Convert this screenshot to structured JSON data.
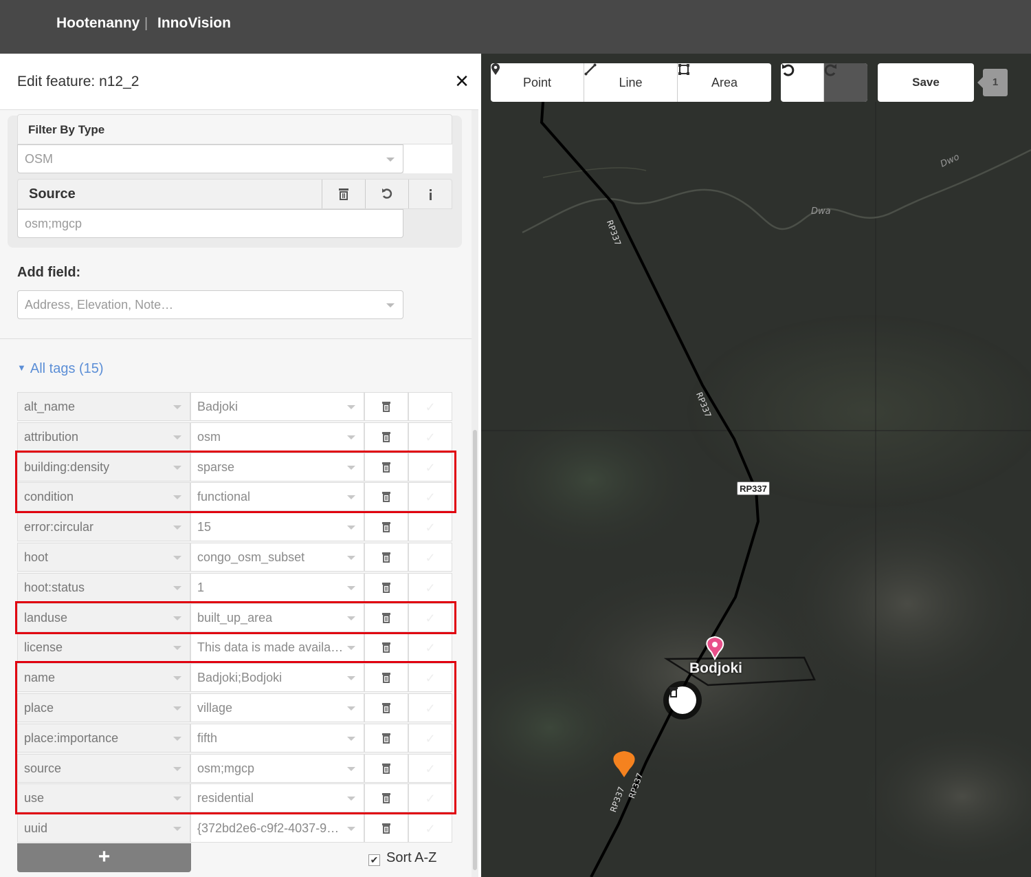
{
  "app": {
    "brand": "Hootenanny",
    "separator": "|",
    "brand2": "InnoVision"
  },
  "sidebar": {
    "title": "Edit feature: n12_2",
    "close_icon": "×",
    "filter_by_type": {
      "label": "Filter By Type",
      "value": "OSM"
    },
    "source": {
      "label": "Source",
      "value": "osm;mgcp",
      "buttons": [
        "trash-icon",
        "undo-icon",
        "info-icon"
      ]
    },
    "add_field": {
      "label": "Add field:",
      "placeholder": "Address, Elevation, Note…"
    },
    "all_tags": {
      "label": "All tags (15)",
      "expanded": true
    },
    "tags": [
      {
        "key": "alt_name",
        "value": "Badjoki"
      },
      {
        "key": "attribution",
        "value": "osm"
      },
      {
        "key": "building:density",
        "value": "sparse"
      },
      {
        "key": "condition",
        "value": "functional"
      },
      {
        "key": "error:circular",
        "value": "15"
      },
      {
        "key": "hoot",
        "value": "congo_osm_subset"
      },
      {
        "key": "hoot:status",
        "value": "1"
      },
      {
        "key": "landuse",
        "value": "built_up_area"
      },
      {
        "key": "license",
        "value": "This data is made availa…"
      },
      {
        "key": "name",
        "value": "Badjoki;Bodjoki"
      },
      {
        "key": "place",
        "value": "village"
      },
      {
        "key": "place:importance",
        "value": "fifth"
      },
      {
        "key": "source",
        "value": "osm;mgcp"
      },
      {
        "key": "use",
        "value": "residential"
      },
      {
        "key": "uuid",
        "value": "{372bd2e6-c9f2-4037-9…"
      }
    ],
    "add_tag_label": "+",
    "sort_label": "Sort A-Z",
    "sort_checked": true,
    "highlight_color": "#e0000f"
  },
  "map": {
    "toolbar": {
      "point": "Point",
      "line": "Line",
      "area": "Area",
      "save": "Save",
      "count": "1"
    },
    "labels": {
      "road": "RP337",
      "river1": "Dwa",
      "river2": "Dwo",
      "place": "Bodjoki"
    },
    "colors": {
      "road": "#000000",
      "marker_pink": "#e8508a",
      "marker_orange": "#f5821f"
    }
  }
}
